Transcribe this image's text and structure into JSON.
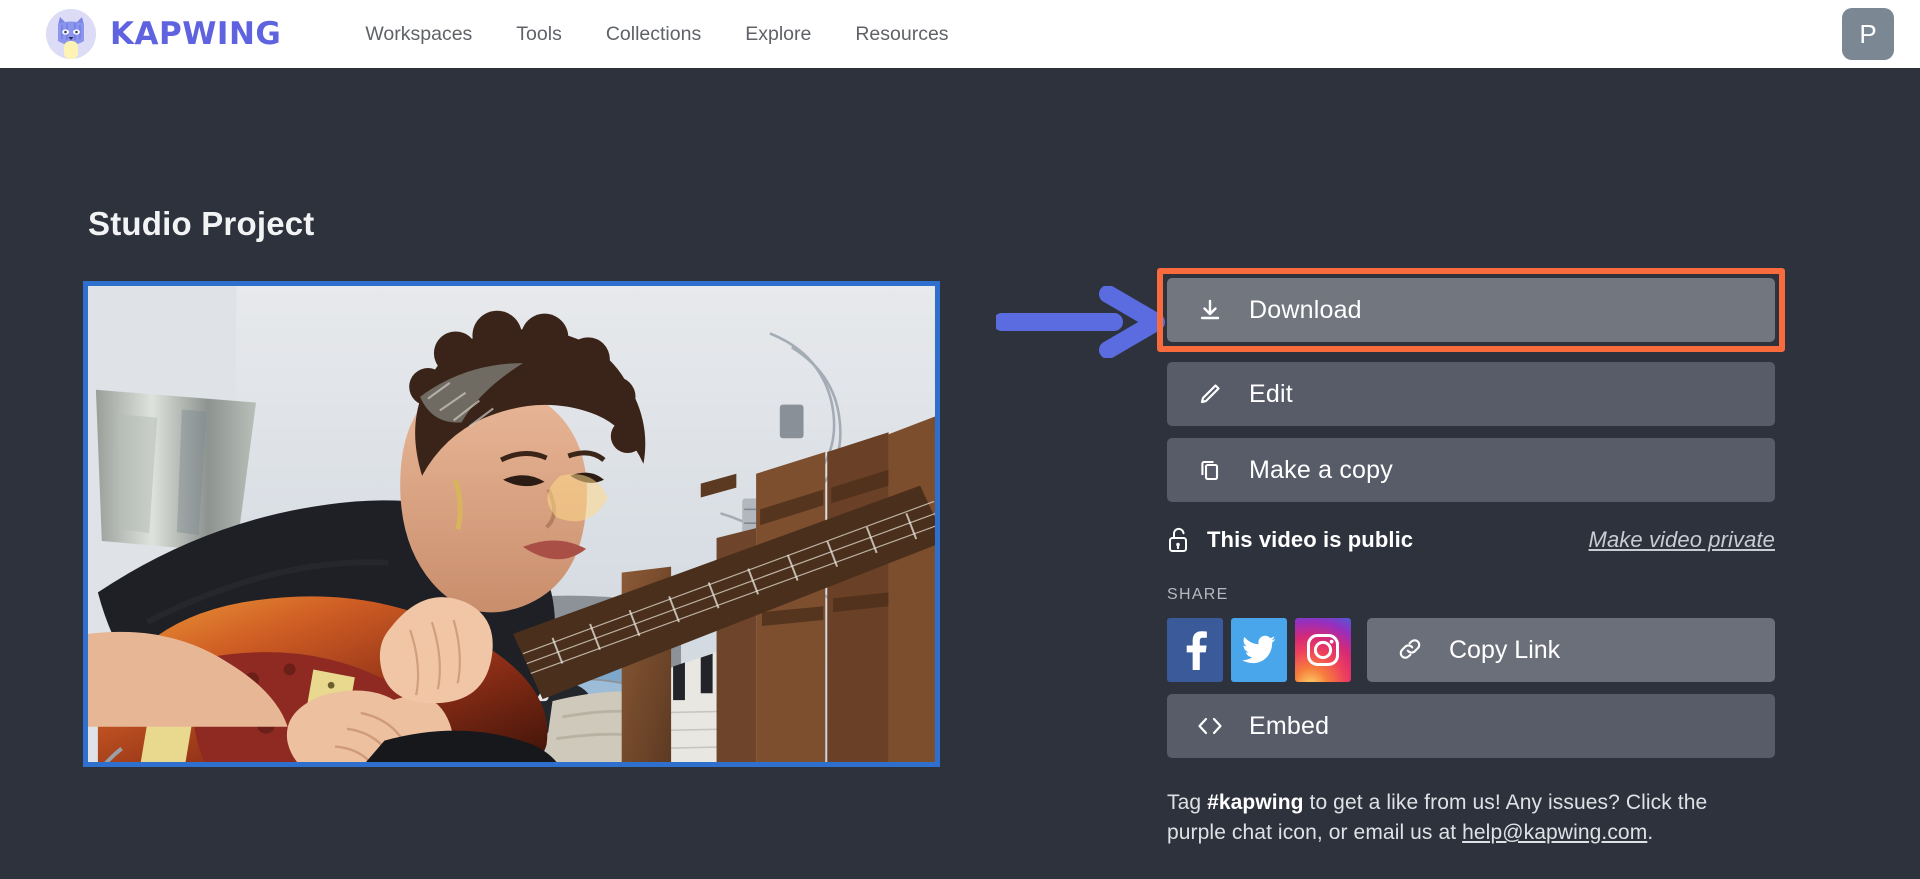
{
  "header": {
    "brand_name": "KAPWING",
    "brand_icon": "kapwing-cat-logo",
    "nav": [
      {
        "label": "Workspaces"
      },
      {
        "label": "Tools"
      },
      {
        "label": "Collections"
      },
      {
        "label": "Explore"
      },
      {
        "label": "Resources"
      }
    ],
    "avatar_initial": "P"
  },
  "main": {
    "page_title": "Studio Project",
    "video": {
      "alt": "Person with curly hair playing a sunburst electric guitar in a room with a lamp, sofa, folded blue blanket, red mug and wooden chairs",
      "border_color": "#2f6fce"
    },
    "actions": [
      {
        "label": "Download",
        "icon": "download-icon",
        "state": "hovered"
      },
      {
        "label": "Edit",
        "icon": "pencil-icon",
        "state": "default"
      },
      {
        "label": "Make a copy",
        "icon": "copy-icon",
        "state": "default"
      }
    ],
    "visibility": {
      "icon": "unlocked-padlock-icon",
      "status_text": "This video is public",
      "toggle_link": "Make video private"
    },
    "share": {
      "heading": "SHARE",
      "socials": [
        {
          "name": "facebook-share-button",
          "label": "Facebook"
        },
        {
          "name": "twitter-share-button",
          "label": "Twitter"
        },
        {
          "name": "instagram-share-button",
          "label": "Instagram"
        }
      ],
      "copy_link_label": "Copy Link",
      "copy_link_icon": "link-icon",
      "embed_label": "Embed",
      "embed_icon": "code-brackets-icon"
    },
    "footer_note": {
      "part1": "Tag ",
      "hashtag": "#kapwing",
      "part2": " to get a like from us! Any issues? Click the purple chat icon, or email us at ",
      "email": "help@kapwing.com",
      "part3": "."
    }
  },
  "annotations": {
    "arrow": {
      "name": "blue-arrow-annotation",
      "color": "#5a6ce0",
      "points_to": "Download"
    },
    "highlight": {
      "name": "orange-highlight-box",
      "color": "#f96a3c",
      "around": "Download"
    }
  },
  "colors": {
    "page_background": "#2e323c",
    "topbar_background": "#ffffff",
    "brand": "#5f63e0",
    "button": "#585c68",
    "button_hover": "#72767f",
    "accent_orange": "#f96a3c",
    "accent_blue": "#5a6ce0"
  }
}
